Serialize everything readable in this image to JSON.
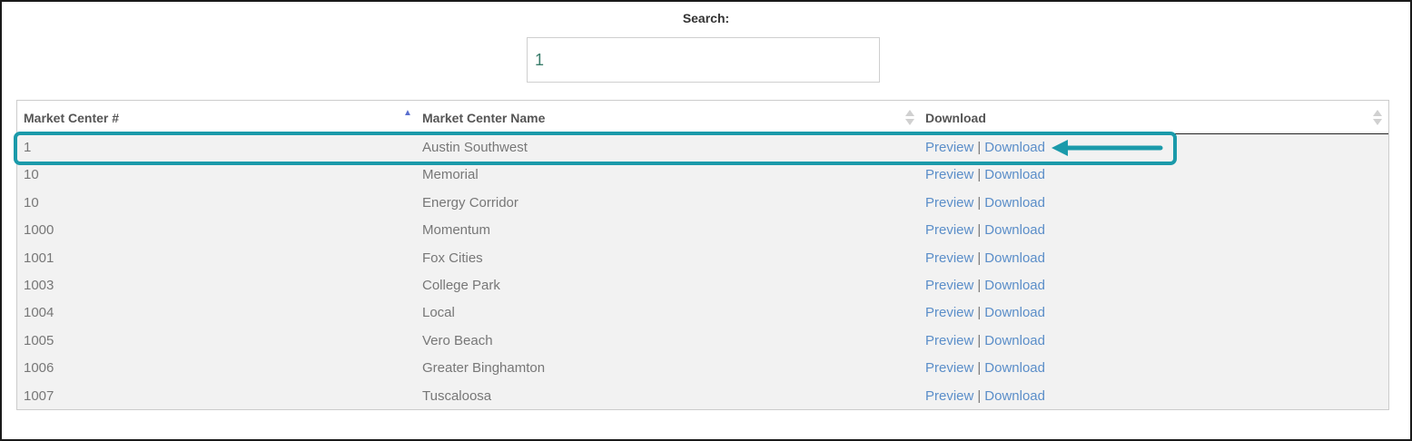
{
  "search": {
    "label": "Search:",
    "value": "1"
  },
  "table": {
    "columns": [
      {
        "label": "Market Center #",
        "sort": "ascending"
      },
      {
        "label": "Market Center Name",
        "sort": "none"
      },
      {
        "label": "Download",
        "sort": "none"
      }
    ],
    "rows": [
      {
        "number": "1",
        "name": "Austin Southwest",
        "preview": "Preview",
        "sep": "|",
        "download": "Download"
      },
      {
        "number": "10",
        "name": "Memorial",
        "preview": "Preview",
        "sep": "|",
        "download": "Download"
      },
      {
        "number": "10",
        "name": "Energy Corridor",
        "preview": "Preview",
        "sep": "|",
        "download": "Download"
      },
      {
        "number": "1000",
        "name": "Momentum",
        "preview": "Preview",
        "sep": "|",
        "download": "Download"
      },
      {
        "number": "1001",
        "name": "Fox Cities",
        "preview": "Preview",
        "sep": "|",
        "download": "Download"
      },
      {
        "number": "1003",
        "name": "College Park",
        "preview": "Preview",
        "sep": "|",
        "download": "Download"
      },
      {
        "number": "1004",
        "name": "Local",
        "preview": "Preview",
        "sep": "|",
        "download": "Download"
      },
      {
        "number": "1005",
        "name": "Vero Beach",
        "preview": "Preview",
        "sep": "|",
        "download": "Download"
      },
      {
        "number": "1006",
        "name": "Greater Binghamton",
        "preview": "Preview",
        "sep": "|",
        "download": "Download"
      },
      {
        "number": "1007",
        "name": "Tuscaloosa",
        "preview": "Preview",
        "sep": "|",
        "download": "Download"
      }
    ]
  },
  "annotation": {
    "color": "#1b9aaa",
    "highlighted_row": 0
  },
  "colors": {
    "link": "#5b8ec9",
    "sort_active": "#5a6fcf"
  }
}
